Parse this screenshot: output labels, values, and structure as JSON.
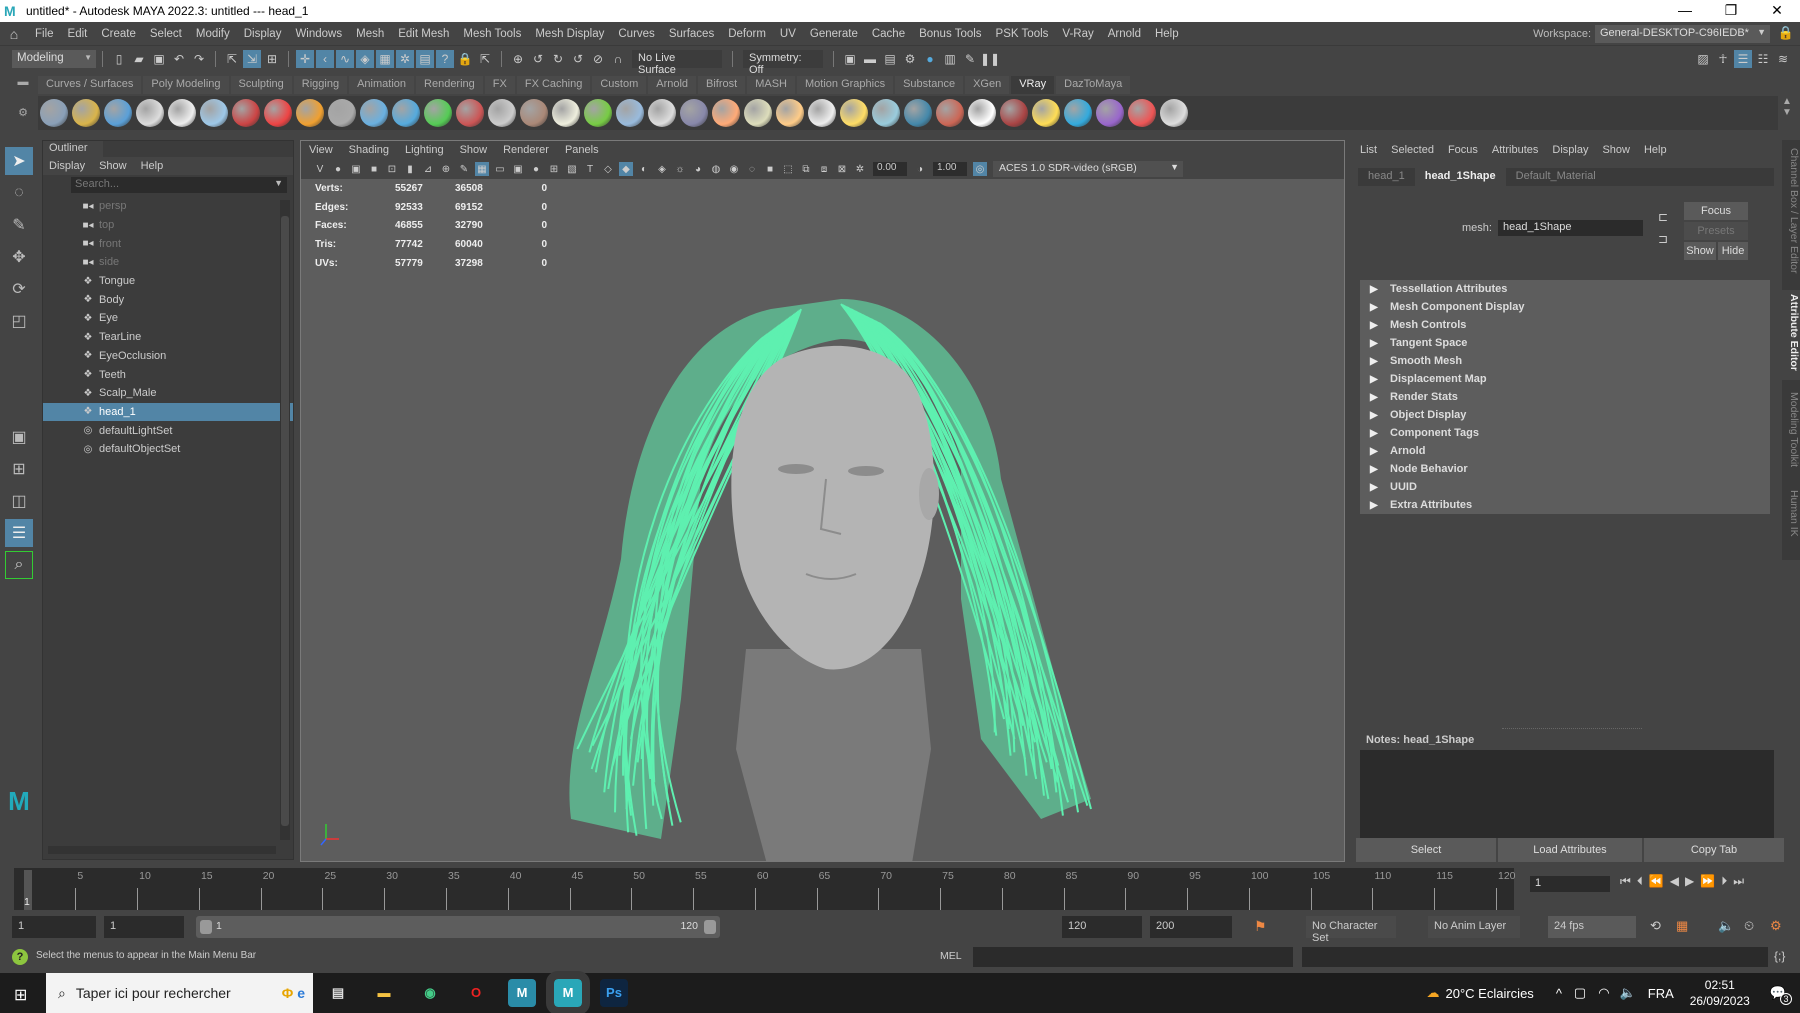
{
  "window": {
    "title": "untitled* - Autodesk MAYA 2022.3: untitled   ---   head_1",
    "controls": [
      "minimize",
      "restore",
      "close"
    ]
  },
  "menubar": {
    "items": [
      "File",
      "Edit",
      "Create",
      "Select",
      "Modify",
      "Display",
      "Windows",
      "Mesh",
      "Edit Mesh",
      "Mesh Tools",
      "Mesh Display",
      "Curves",
      "Surfaces",
      "Deform",
      "UV",
      "Generate",
      "Cache",
      "Bonus Tools",
      "PSK Tools",
      "V-Ray",
      "Arnold",
      "Help"
    ],
    "workspace_label": "Workspace:",
    "workspace_value": "General-DESKTOP-C96IEDB*"
  },
  "statusline": {
    "mode": "Modeling",
    "live_surface": "No Live Surface",
    "symmetry": "Symmetry: Off"
  },
  "shelf": {
    "tabs": [
      "Curves / Surfaces",
      "Poly Modeling",
      "Sculpting",
      "Rigging",
      "Animation",
      "Rendering",
      "FX",
      "FX Caching",
      "Custom",
      "Arnold",
      "Bifrost",
      "MASH",
      "Motion Graphics",
      "Substance",
      "XGen",
      "VRay",
      "DazToMaya"
    ],
    "active_tab": "VRay",
    "icon_colors": [
      "#8aa0b8",
      "#d9b44a",
      "#5aa0d8",
      "#ddd",
      "#eee",
      "#9ec8e8",
      "#c44",
      "#e44",
      "#f0a030",
      "#aaa",
      "#6ab0e0",
      "#5ad",
      "#5c5",
      "#c55",
      "#ccc",
      "#a87",
      "#eed",
      "#7c4",
      "#9bd",
      "#ddd",
      "#88a",
      "#fa7",
      "#ddb",
      "#fc8",
      "#eee",
      "#fd6",
      "#9cd",
      "#48a",
      "#c65",
      "#fff",
      "#a44",
      "#fd5",
      "#3ad",
      "#96c",
      "#e55",
      "#ddd"
    ]
  },
  "outliner": {
    "title": "Outliner",
    "menu": [
      "Display",
      "Show",
      "Help"
    ],
    "search_placeholder": "Search...",
    "items": [
      {
        "label": "persp",
        "type": "camera"
      },
      {
        "label": "top",
        "type": "camera"
      },
      {
        "label": "front",
        "type": "camera"
      },
      {
        "label": "side",
        "type": "camera"
      },
      {
        "label": "Tongue",
        "type": "mesh"
      },
      {
        "label": "Body",
        "type": "mesh"
      },
      {
        "label": "Eye",
        "type": "mesh"
      },
      {
        "label": "TearLine",
        "type": "mesh"
      },
      {
        "label": "EyeOcclusion",
        "type": "mesh"
      },
      {
        "label": "Teeth",
        "type": "mesh"
      },
      {
        "label": "Scalp_Male",
        "type": "mesh"
      },
      {
        "label": "head_1",
        "type": "mesh",
        "selected": true
      },
      {
        "label": "defaultLightSet",
        "type": "set"
      },
      {
        "label": "defaultObjectSet",
        "type": "set"
      }
    ]
  },
  "viewport": {
    "menu": [
      "View",
      "Shading",
      "Lighting",
      "Show",
      "Renderer",
      "Panels"
    ],
    "exposure": "0.00",
    "gamma": "1.00",
    "color_space": "ACES 1.0 SDR-video (sRGB)",
    "hud": [
      {
        "label": "Verts:",
        "a": "55267",
        "b": "36508",
        "c": "0"
      },
      {
        "label": "Edges:",
        "a": "92533",
        "b": "69152",
        "c": "0"
      },
      {
        "label": "Faces:",
        "a": "46855",
        "b": "32790",
        "c": "0"
      },
      {
        "label": "Tris:",
        "a": "77742",
        "b": "60040",
        "c": "0"
      },
      {
        "label": "UVs:",
        "a": "57779",
        "b": "37298",
        "c": "0"
      }
    ],
    "wire_color": "#5ef0b0"
  },
  "attribute_editor": {
    "menu": [
      "List",
      "Selected",
      "Focus",
      "Attributes",
      "Display",
      "Show",
      "Help"
    ],
    "tabs": [
      "head_1",
      "head_1Shape",
      "Default_Material"
    ],
    "active_tab": "head_1Shape",
    "mesh_label": "mesh:",
    "mesh_value": "head_1Shape",
    "focus_button": "Focus",
    "presets_button": "Presets",
    "show_button": "Show",
    "hide_button": "Hide",
    "sections": [
      "Tessellation Attributes",
      "Mesh Component Display",
      "Mesh Controls",
      "Tangent Space",
      "Smooth Mesh",
      "Displacement Map",
      "Render Stats",
      "Object Display",
      "Component Tags",
      "Arnold",
      "Node Behavior",
      "UUID",
      "Extra Attributes"
    ],
    "notes_label": "Notes:  head_1Shape",
    "bottom_buttons": [
      "Select",
      "Load Attributes",
      "Copy Tab"
    ]
  },
  "side_tabs": [
    "Channel Box / Layer Editor",
    "Attribute Editor",
    "Modeling Toolkit",
    "Human IK"
  ],
  "side_tab_active": "Attribute Editor",
  "timeline": {
    "ticks": [
      5,
      10,
      15,
      20,
      25,
      30,
      35,
      40,
      45,
      50,
      55,
      60,
      65,
      70,
      75,
      80,
      85,
      90,
      95,
      100,
      105,
      110,
      115,
      120
    ],
    "start": 1,
    "end": 120,
    "current_frame": "1",
    "current_frame_label": "1"
  },
  "range": {
    "start_field": "1",
    "playback_start": "1",
    "slider_start_label": "1",
    "slider_end_label": "120",
    "playback_end": "120",
    "end_field": "200",
    "character_set": "No Character Set",
    "anim_layer": "No Anim Layer",
    "fps": "24 fps"
  },
  "commandline": {
    "help_message": "Select the menus to appear in the Main Menu Bar",
    "language": "MEL"
  },
  "taskbar": {
    "search_placeholder": "Taper ici pour rechercher",
    "apps": [
      "Task View",
      "File Explorer",
      "Chrome",
      "Opera",
      "Maya 2022 (alt)",
      "Maya",
      "Photoshop"
    ],
    "weather": "20°C  Eclaircies",
    "language": "FRA",
    "time": "02:51",
    "date": "26/09/2023",
    "notifications": "3"
  }
}
